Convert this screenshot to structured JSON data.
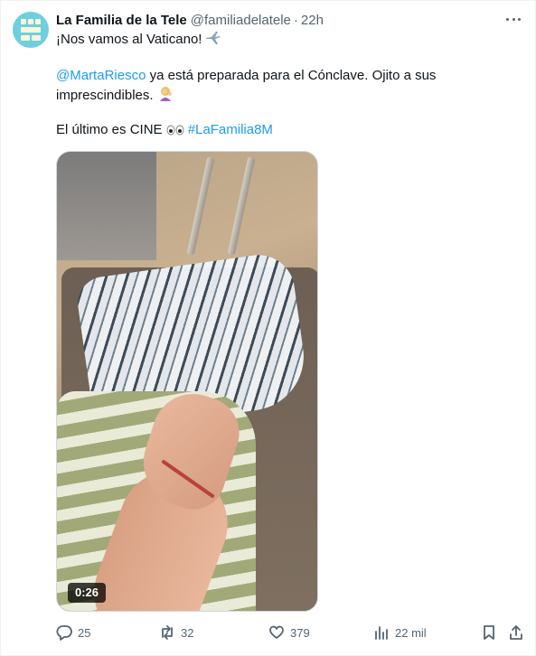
{
  "tweet": {
    "author_name": "La Familia de la Tele",
    "author_handle": "@familiadelatele",
    "separator": "·",
    "time": "22h",
    "line1": "¡Nos vamos al Vaticano!",
    "line1_emoji": "✈️",
    "mention": "@MartaRiesco",
    "line2_rest": " ya está preparada para el Cónclave. Ojito a sus",
    "line3": "imprescindibles.",
    "line3_emoji": "💁",
    "line4_text": "El último es CINE",
    "line4_emoji": "👀",
    "hashtag": "#LaFamilia8M",
    "video_duration": "0:26"
  },
  "actions": {
    "replies": "25",
    "retweets": "32",
    "likes": "379",
    "views": "22 mil"
  },
  "colors": {
    "link": "#1d9bf0",
    "secondary_text": "#536471",
    "primary_text": "#0f1419",
    "avatar_bg": "#6fcfe0"
  }
}
